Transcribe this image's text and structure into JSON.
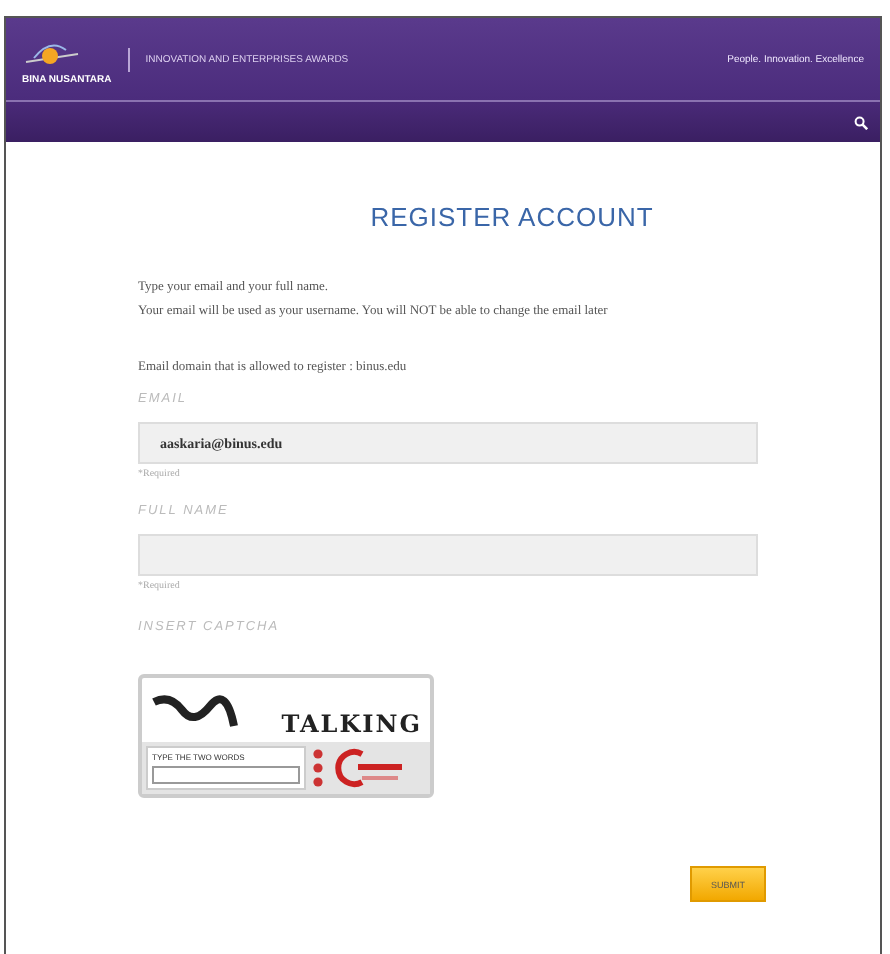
{
  "header": {
    "logo_text": "BINA NUSANTARA",
    "site_title": "INNOVATION AND ENTERPRISES AWARDS",
    "tagline": "People. Innovation. Excellence"
  },
  "form": {
    "title": "REGISTER ACCOUNT",
    "intro": [
      "Type your email and your full name.",
      "Your email will be used as your username. You will NOT be able to change the email later"
    ],
    "domain_note": "Email domain that is allowed to register : binus.edu",
    "fields": [
      {
        "label": "EMAIL",
        "value": "aaskaria@binus.edu",
        "hint": "*Required"
      },
      {
        "label": "FULL NAME",
        "hint": "*Required"
      }
    ],
    "captcha": {
      "label": "INSERT CAPTCHA",
      "word": "TALKING",
      "prompt": "TYPE THE TWO WORDS"
    },
    "submit": "SUBMIT"
  }
}
